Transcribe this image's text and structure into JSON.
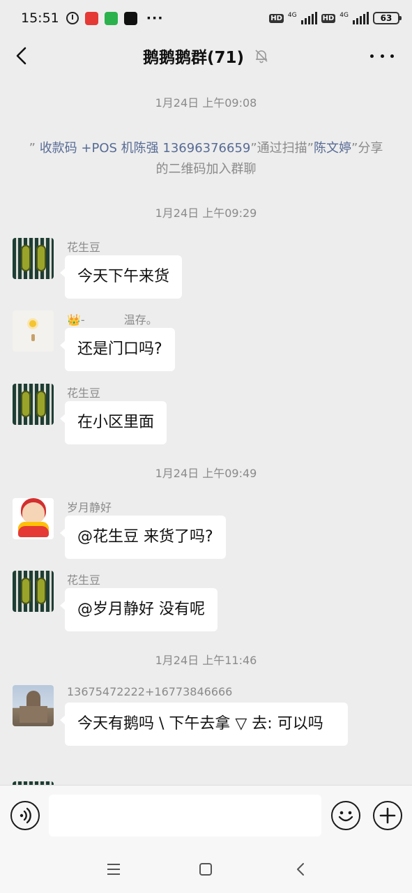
{
  "status_bar": {
    "time": "15:51",
    "network_1": "4G",
    "network_2": "4G",
    "hd_1": "HD",
    "hd_2": "HD",
    "battery": "63",
    "more": "···"
  },
  "header": {
    "title": "鹅鹅鹅群(71)",
    "icons": [
      "back-arrow-icon",
      "bell-muted-icon",
      "more-dots-icon"
    ]
  },
  "chat": {
    "items": [
      {
        "kind": "timestamp",
        "text": "1月24日 上午09:08"
      },
      {
        "kind": "system",
        "quote_open": "” ",
        "name_1": "收款码 +POS 机陈强 13696376659",
        "mid": "”通过扫描”",
        "name_2": "陈文婷",
        "tail": "”分享的二维码加入群聊"
      },
      {
        "kind": "timestamp",
        "text": "1月24日 上午09:29"
      },
      {
        "kind": "message",
        "sender": "花生豆",
        "text": "今天下午来货",
        "avatar": "peanut-avatar"
      },
      {
        "kind": "message",
        "sender_prefix": "-",
        "sender": "温存。",
        "text": "还是门口吗?",
        "avatar": "flower-avatar"
      },
      {
        "kind": "message",
        "sender": "花生豆",
        "text": "在小区里面",
        "avatar": "peanut-avatar"
      },
      {
        "kind": "timestamp",
        "text": "1月24日 上午09:49"
      },
      {
        "kind": "message",
        "sender": "岁月静好",
        "text": "@花生豆  来货了吗?",
        "avatar": "fortune-god-avatar"
      },
      {
        "kind": "message",
        "sender": "花生豆",
        "text": "@岁月静好  没有呢",
        "avatar": "peanut-avatar"
      },
      {
        "kind": "timestamp",
        "text": "1月24日 上午11:46"
      },
      {
        "kind": "message",
        "sender": "13675472222+16773846666",
        "text": "今天有鹅吗 \\ 下午去拿 ▽ 去: 可以吗",
        "avatar": "cathedral-avatar"
      }
    ]
  },
  "input_bar": {
    "placeholder": "",
    "icons": [
      "voice-icon",
      "emoji-icon",
      "plus-icon"
    ]
  },
  "nav_bar": {
    "icons": [
      "menu-icon",
      "home-icon",
      "back-icon"
    ]
  }
}
